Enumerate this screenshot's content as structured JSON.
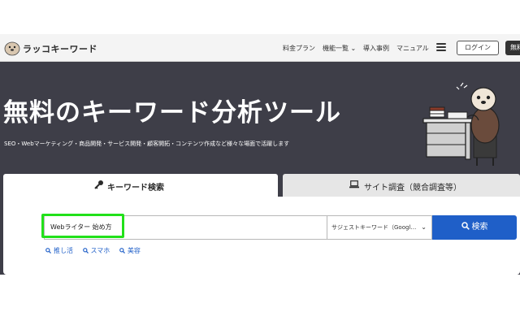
{
  "header": {
    "brand": "ラッコキーワード",
    "nav": [
      {
        "label": "料金プラン"
      },
      {
        "label": "機能一覧"
      },
      {
        "label": "導入事例"
      },
      {
        "label": "マニュアル"
      }
    ],
    "login_label": "ログイン",
    "trial_label": "無料"
  },
  "hero": {
    "title": "無料のキーワード分析ツール",
    "subtitle": "SEO・Webマーケティング・商品開発・サービス開発・顧客開拓・コンテンツ作成など様々な場面で活躍します"
  },
  "tabs": {
    "keyword_label": "キーワード検索",
    "site_label": "サイト調査（競合調査等）"
  },
  "search": {
    "input_value": "Webライター 始め方",
    "suggest_value": "サジェストキーワード（Googl…",
    "button_label": "検索",
    "quick_links": [
      "推し活",
      "スマホ",
      "美容"
    ]
  },
  "colors": {
    "hero_bg": "#3e3e48",
    "primary": "#1f5fc8",
    "highlight": "#22e11a"
  }
}
